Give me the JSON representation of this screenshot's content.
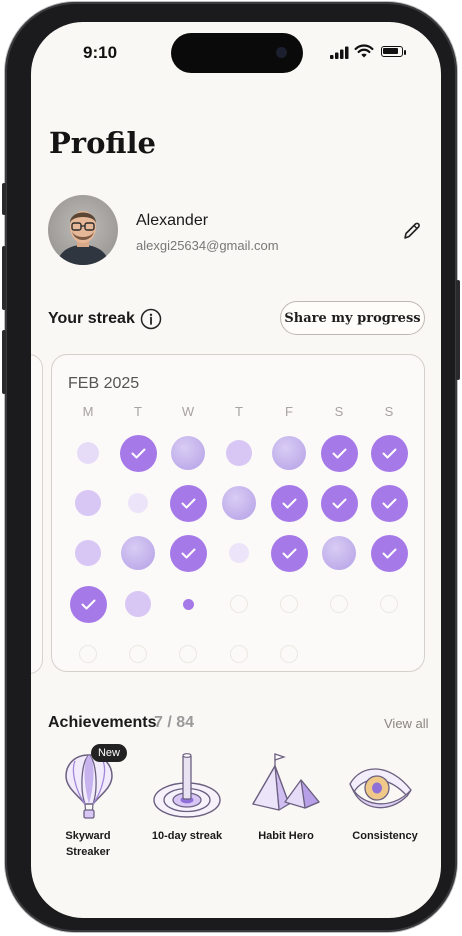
{
  "status_bar": {
    "time": "9:10"
  },
  "profile": {
    "title": "Profile",
    "name": "Alexander",
    "email": "alexgi25634@gmail.com"
  },
  "streak": {
    "title": "Your streak",
    "share_label": "Share my progress",
    "month": "FEB 2025",
    "weekdays": [
      "M",
      "T",
      "W",
      "T",
      "F",
      "S",
      "S"
    ],
    "weeks": [
      [
        "light-s",
        "check",
        "mid",
        "light",
        "mid",
        "check",
        "check"
      ],
      [
        "light",
        "light-xs",
        "check",
        "mid",
        "check",
        "check",
        "check"
      ],
      [
        "light",
        "mid",
        "check",
        "light-xs",
        "check",
        "mid",
        "check"
      ],
      [
        "check",
        "light",
        "dot",
        "empty",
        "empty",
        "empty",
        "empty"
      ],
      [
        "empty",
        "empty",
        "empty",
        "empty",
        "empty",
        "",
        ""
      ]
    ]
  },
  "achievements": {
    "title": "Achievements",
    "count": "7 / 84",
    "view_all": "View all",
    "new_tag": "New",
    "items": [
      {
        "label": "Skyward Streaker",
        "icon": "hot-air-balloon-icon"
      },
      {
        "label": "10-day streak",
        "icon": "target-icon"
      },
      {
        "label": "Habit Hero",
        "icon": "mountain-flag-icon"
      },
      {
        "label": "Consistency",
        "icon": "eye-icon"
      }
    ]
  },
  "colors": {
    "accent": "#a679e8",
    "accent_light": "#d8c6f5",
    "background": "#faf8f4"
  }
}
